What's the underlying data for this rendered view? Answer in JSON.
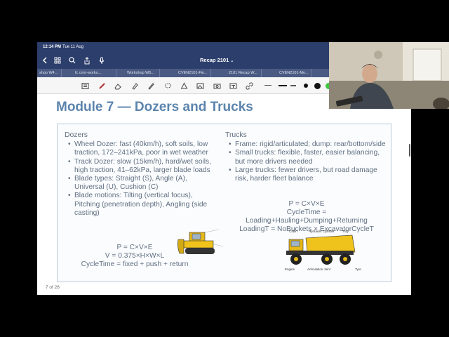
{
  "status_bar": {
    "time": "12:14 PM",
    "date": "Tue 11 Aug"
  },
  "nav_bar": {
    "title": "Recap 2101",
    "icons": [
      "back-chevron-icon",
      "grid-icon",
      "search-icon",
      "share-icon",
      "microphone-icon"
    ]
  },
  "tabs": [
    {
      "label": "shop W4..."
    },
    {
      "label": "fc cnm-works..."
    },
    {
      "label": "Workshop W5..."
    },
    {
      "label": "CVEN2101-Fin..."
    },
    {
      "label": "2101 Recap W..."
    },
    {
      "label": "CVEN2101-Mo..."
    }
  ],
  "toolbar": {
    "tools": [
      "read-mode-icon",
      "pen-icon",
      "eraser-icon",
      "highlighter-icon",
      "pencil-icon",
      "lasso-icon",
      "shapes-icon",
      "image-icon",
      "camera-icon",
      "text-icon",
      "link-icon"
    ],
    "colors": [
      "#111111",
      "#111111",
      "#3ec73e"
    ]
  },
  "slide": {
    "title": "Module 7 — Dozers and Trucks",
    "dozers": {
      "heading": "Dozers",
      "bullets": [
        "Wheel Dozer: fast (40km/h), soft soils, low traction, 172–241kPa, poor in wet weather",
        "Track Dozer: slow (15km/h), hard/wet soils, high traction, 41–62kPa, larger blade loads",
        "Blade types: Straight (S), Angle (A), Universal (U), Cushion (C)",
        "Blade motions: Tilting (vertical focus), Pitching (penetration depth), Angling (side casting)"
      ],
      "formulas": [
        "P = C×V×E",
        "V = 0.375×H×W×L",
        "CycleTime = fixed + push + return"
      ]
    },
    "trucks": {
      "heading": "Trucks",
      "bullets": [
        "Frame: rigid/articulated; dump: rear/bottom/side",
        "Small trucks: flexible, faster, easier balancing, but more drivers needed",
        "Large trucks: fewer drivers, but road damage risk, harder fleet balance"
      ],
      "formulas": [
        "P = C×V×E",
        "CycleTime = Loading+Hauling+Dumping+Returning",
        "LoadingT = NoBuckets × ExcavatorCycleT"
      ],
      "diagram_labels": [
        "Cabin",
        "Hydraulic Cylinder",
        "Tray",
        "Engine",
        "Articulation Joint",
        "Tyre"
      ]
    },
    "page_indicator": "7 of 26"
  }
}
